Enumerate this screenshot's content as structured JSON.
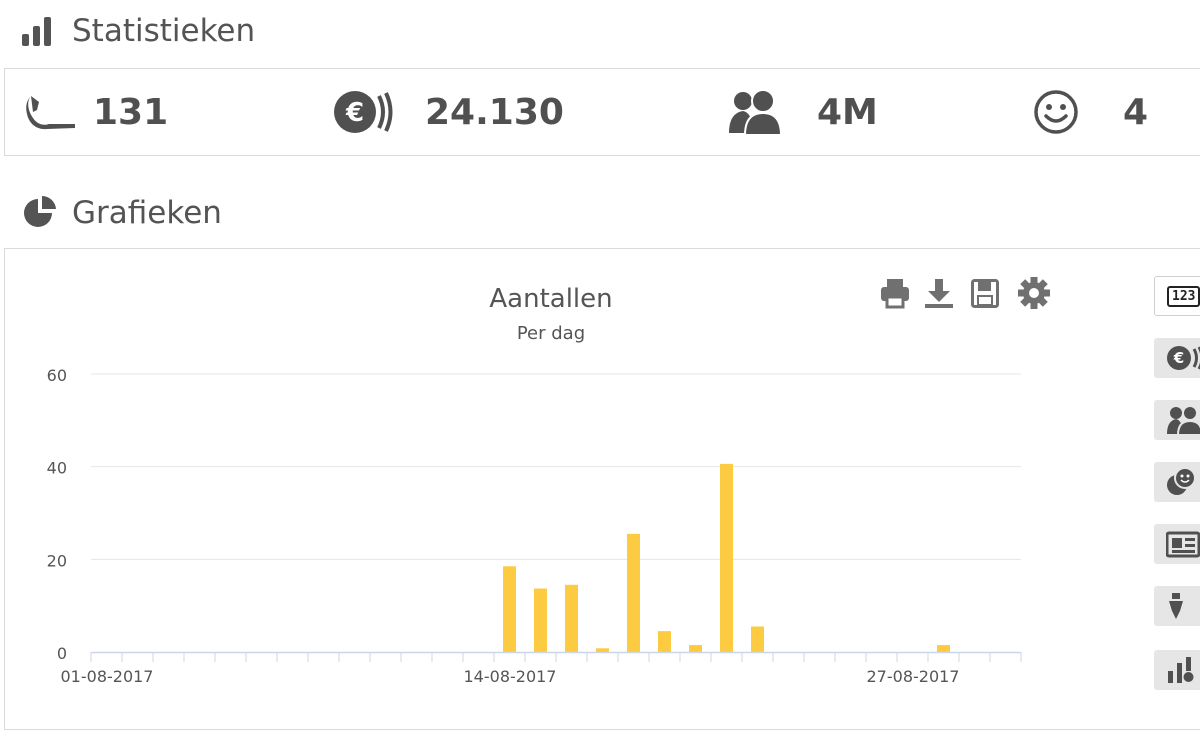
{
  "statistics": {
    "title": "Statistieken",
    "items": [
      {
        "icon": "call-icon",
        "value": "131"
      },
      {
        "icon": "euro-icon",
        "value": "24.130"
      },
      {
        "icon": "users-icon",
        "value": "4M"
      },
      {
        "icon": "smiley-icon",
        "value": "4"
      }
    ]
  },
  "charts": {
    "title": "Grafieken",
    "toolbar": [
      "print-icon",
      "download-icon",
      "save-icon",
      "settings-icon"
    ],
    "side_buttons": [
      {
        "icon": "counter-123-icon",
        "label": "123",
        "active": true
      },
      {
        "icon": "euro-icon",
        "active": false
      },
      {
        "icon": "users-icon",
        "active": false
      },
      {
        "icon": "coins-icon",
        "active": false
      },
      {
        "icon": "newspaper-icon",
        "active": false
      },
      {
        "icon": "pen-icon",
        "active": false
      },
      {
        "icon": "bar-chart-icon",
        "active": false
      }
    ]
  },
  "colors": {
    "bar": "#fccb41",
    "grid": "#e6e6e6",
    "axis": "#ccd6eb",
    "text": "#555555"
  },
  "chart_data": {
    "type": "bar",
    "title": "Aantallen",
    "subtitle": "Per dag",
    "xlabel": "",
    "ylabel": "",
    "ylim": [
      0,
      60
    ],
    "yticks": [
      0,
      20,
      40,
      60
    ],
    "grid": true,
    "xticklabels": [
      {
        "date": "01-08-2017",
        "label": "01-08-2017"
      },
      {
        "date": "14-08-2017",
        "label": "14-08-2017"
      },
      {
        "date": "27-08-2017",
        "label": "27-08-2017"
      }
    ],
    "categories": [
      "01-08-2017",
      "02-08-2017",
      "03-08-2017",
      "04-08-2017",
      "05-08-2017",
      "06-08-2017",
      "07-08-2017",
      "08-08-2017",
      "09-08-2017",
      "10-08-2017",
      "11-08-2017",
      "12-08-2017",
      "13-08-2017",
      "14-08-2017",
      "15-08-2017",
      "16-08-2017",
      "17-08-2017",
      "18-08-2017",
      "19-08-2017",
      "20-08-2017",
      "21-08-2017",
      "22-08-2017",
      "23-08-2017",
      "24-08-2017",
      "25-08-2017",
      "26-08-2017",
      "27-08-2017",
      "28-08-2017",
      "29-08-2017",
      "30-08-2017"
    ],
    "values": [
      0,
      0,
      0,
      0,
      0,
      0,
      0,
      0,
      0,
      0,
      0,
      0,
      0,
      18.5,
      13.7,
      14.5,
      0.8,
      25.5,
      4.5,
      1.5,
      40.6,
      5.5,
      0,
      0,
      0,
      0,
      0,
      1.5,
      0,
      0
    ]
  }
}
